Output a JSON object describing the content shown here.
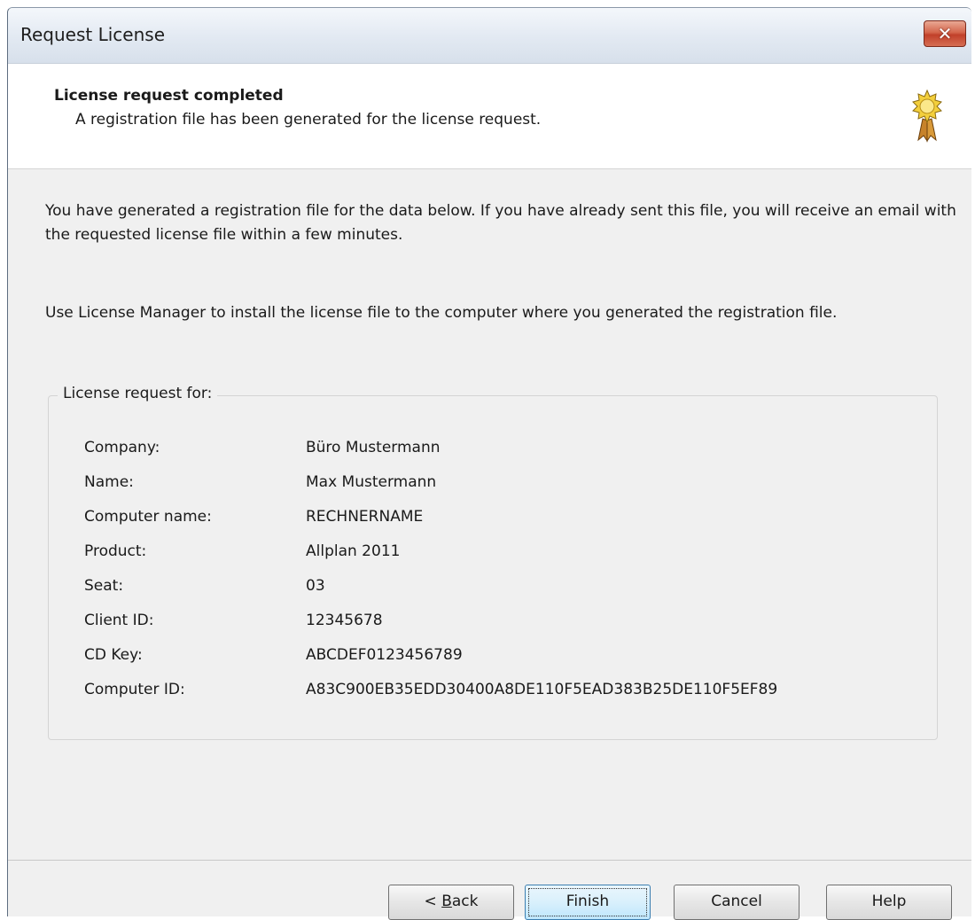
{
  "window": {
    "title": "Request License",
    "close_glyph": "✕",
    "close_icon": "close-icon"
  },
  "header": {
    "title": "License request completed",
    "subtitle": "A registration file has been generated for the license request.",
    "icon": "seal-icon"
  },
  "body": {
    "paragraph1": "You have generated a registration file for the data below. If you have already sent this file, you will receive an email with the requested license file within a few minutes.",
    "paragraph2": "Use License Manager to install the license file to the computer where you generated the registration file."
  },
  "group": {
    "label": "License request for:",
    "rows": [
      {
        "key": "Company:",
        "value": "Büro Mustermann"
      },
      {
        "key": "Name:",
        "value": "Max Mustermann"
      },
      {
        "key": "Computer name:",
        "value": "RECHNERNAME"
      },
      {
        "key": "Product:",
        "value": "Allplan 2011"
      },
      {
        "key": "Seat:",
        "value": "03"
      },
      {
        "key": "Client ID:",
        "value": "12345678"
      },
      {
        "key": "CD Key:",
        "value": "ABCDEF0123456789"
      },
      {
        "key": "Computer ID:",
        "value": "A83C900EB35EDD30400A8DE110F5EAD383B25DE110F5EF89"
      }
    ]
  },
  "buttons": {
    "back_prefix": "< ",
    "back_mnemonic": "B",
    "back_rest": "ack",
    "finish": "Finish",
    "cancel": "Cancel",
    "help": "Help"
  },
  "colors": {
    "close_red": "#c1402a",
    "default_button_border": "#3c7fb1"
  }
}
